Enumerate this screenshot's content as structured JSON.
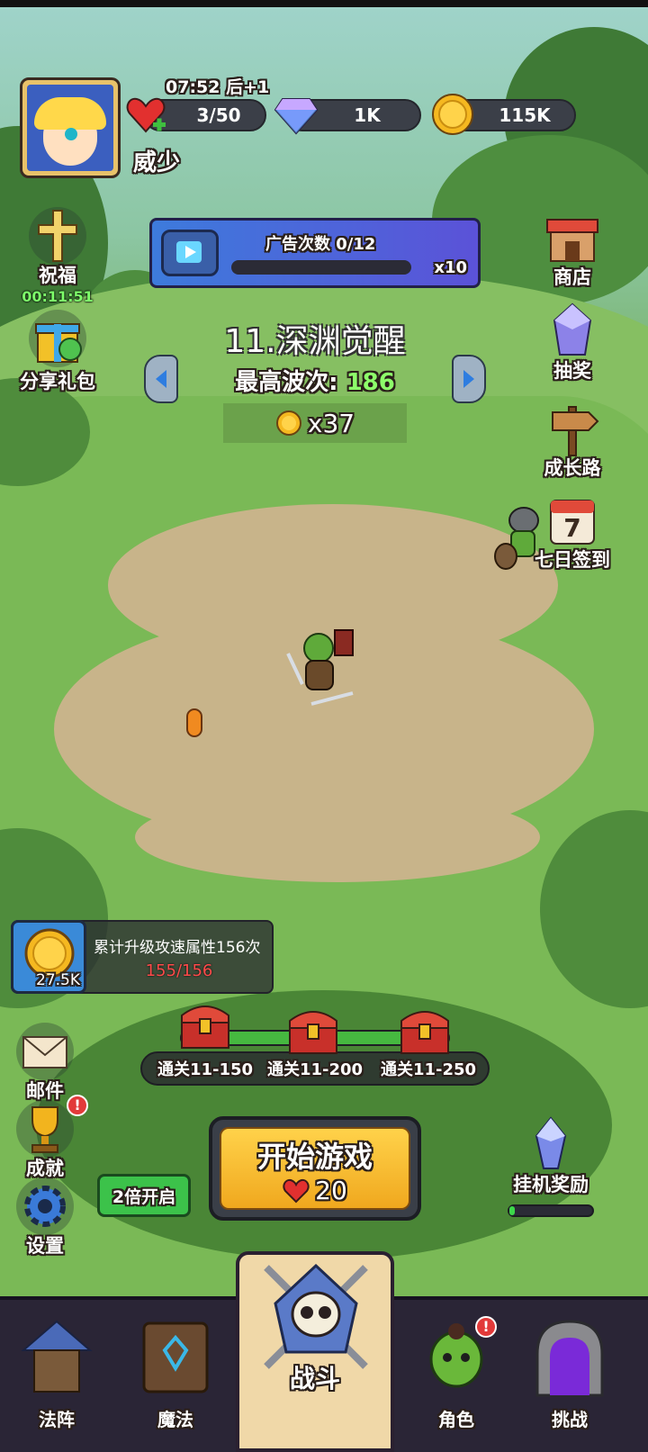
{
  "player": {
    "name": "威少"
  },
  "energy": {
    "timer": "07:52 后+1",
    "value": "3/50"
  },
  "gems": {
    "value": "1K"
  },
  "coins": {
    "value": "115K"
  },
  "blessing": {
    "label": "祝福",
    "timer": "00:11:51"
  },
  "share_gift": {
    "label": "分享礼包"
  },
  "ad_panel": {
    "label": "广告次数 0/12",
    "multiplier": "x10",
    "progress": 0
  },
  "stage": {
    "title": "11.深渊觉醒",
    "best_wave_label": "最高波次:",
    "best_wave_value": "186",
    "reward": "x37"
  },
  "right_menu": {
    "shop": "商店",
    "lottery": "抽奖",
    "growth": "成长路",
    "seven_day": "七日签到",
    "seven_day_number": "7"
  },
  "quest": {
    "title": "累计升级攻速属性156次",
    "progress": "155/156",
    "reward": "27.5K"
  },
  "chests": [
    "通关11-150",
    "通关11-200",
    "通关11-250"
  ],
  "left_menu": {
    "mail": "邮件",
    "achievement": "成就",
    "settings": "设置",
    "double": "2倍开启"
  },
  "start": {
    "label": "开始游戏",
    "cost": "20"
  },
  "idle": {
    "label": "挂机奖励",
    "progress": 0.06
  },
  "nav": {
    "formation": "法阵",
    "magic": "魔法",
    "battle": "战斗",
    "character": "角色",
    "challenge": "挑战"
  },
  "badge_text": "!"
}
